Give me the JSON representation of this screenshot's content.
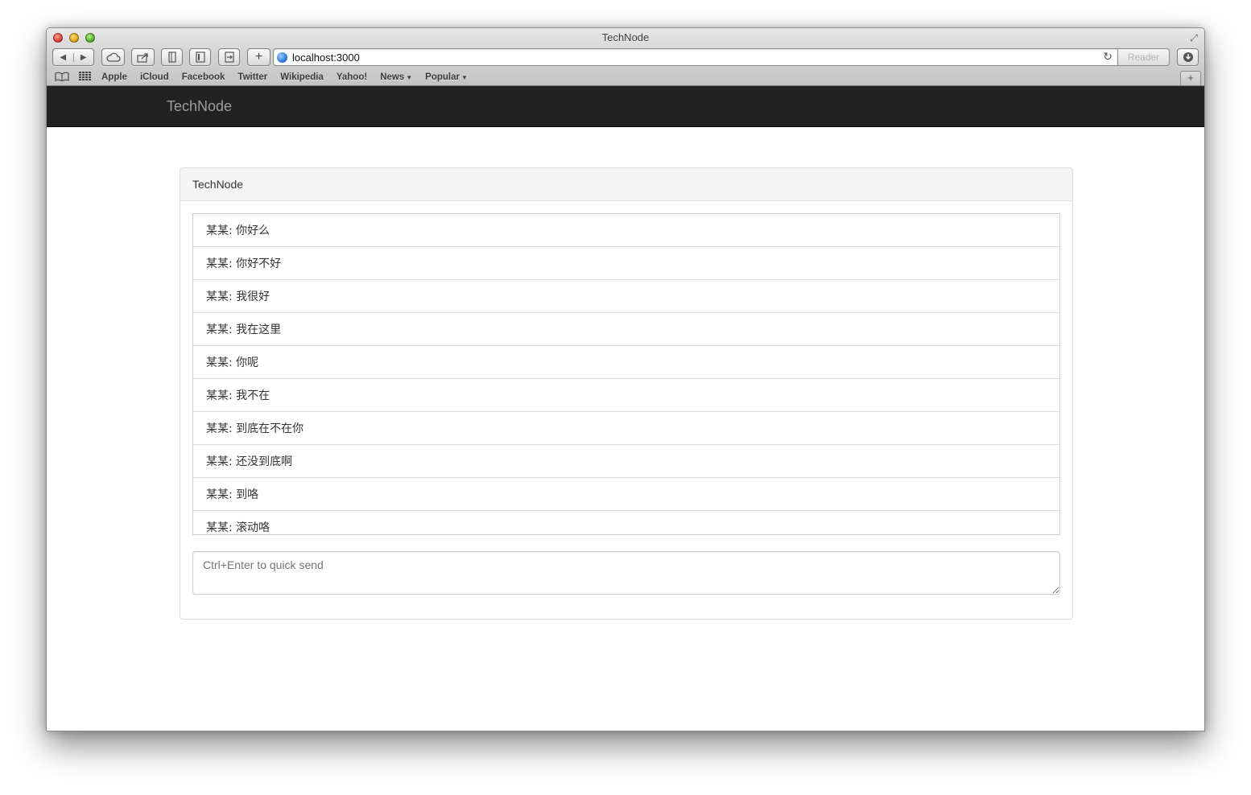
{
  "window": {
    "title": "TechNode"
  },
  "toolbar": {
    "back_icon": "◀",
    "forward_icon": "▶",
    "url": "localhost:3000",
    "reader_label": "Reader"
  },
  "bookmarks": {
    "items": [
      "Apple",
      "iCloud",
      "Facebook",
      "Twitter",
      "Wikipedia",
      "Yahoo!"
    ],
    "news_label": "News",
    "popular_label": "Popular"
  },
  "navbar": {
    "brand": "TechNode"
  },
  "panel": {
    "heading": "TechNode",
    "messages": [
      "某某: 你好么",
      "某某: 你好不好",
      "某某: 我很好",
      "某某: 我在这里",
      "某某: 你呢",
      "某某: 我不在",
      "某某: 到底在不在你",
      "某某: 还没到底啊",
      "某某: 到咯",
      "某某: 滚动咯"
    ],
    "compose_placeholder": "Ctrl+Enter to quick send"
  }
}
